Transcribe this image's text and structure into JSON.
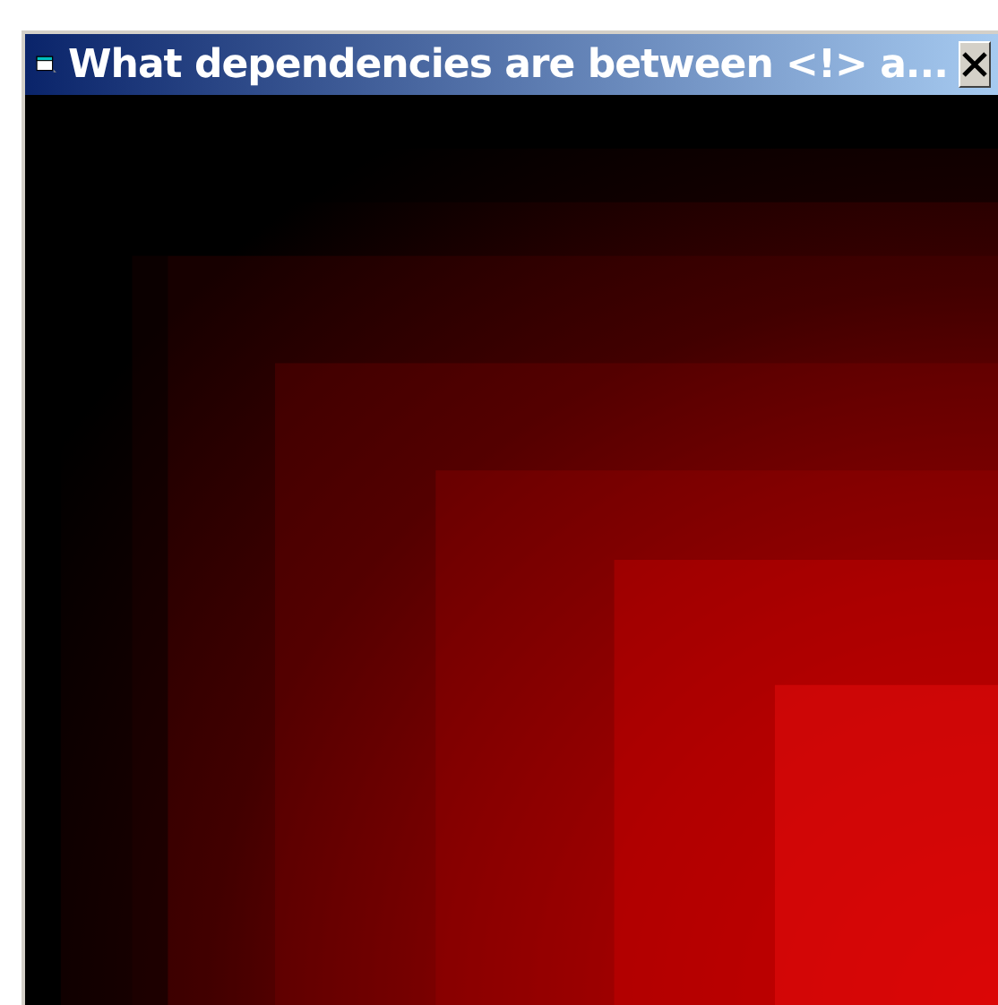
{
  "window": {
    "title": "What dependencies are between <!> a..."
  }
}
